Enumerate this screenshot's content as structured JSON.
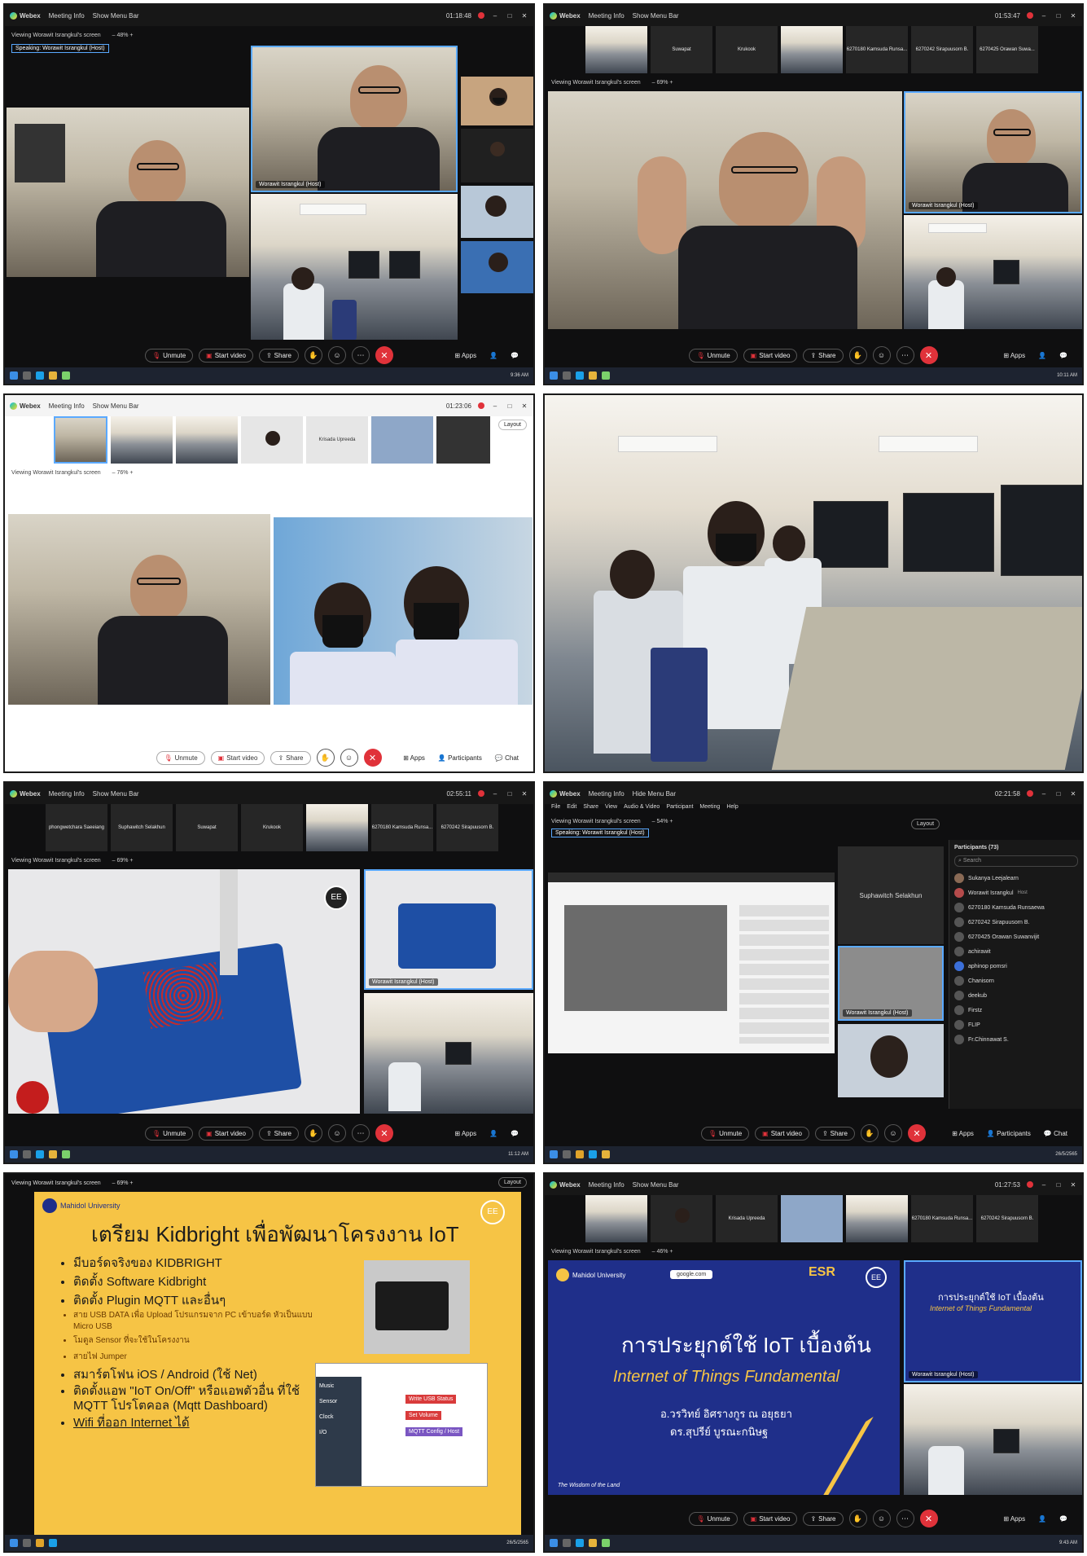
{
  "app": {
    "name": "Webex",
    "meeting_info": "Meeting Info",
    "show_menu_bar": "Show Menu Bar",
    "hide_menu_bar": "Hide Menu Bar",
    "layout": "Layout"
  },
  "controls": {
    "unmute": "Unmute",
    "start_video": "Start video",
    "share": "Share",
    "apps": "Apps",
    "participants": "Participants",
    "chat": "Chat"
  },
  "p1": {
    "timer": "01:18:48",
    "viewing": "Viewing Worawit Israngkul's screen",
    "zoom": "48%",
    "speaking": "Speaking: Worawit Israngkul (Host)",
    "host_caption": "Worawit Israngkul (Host)",
    "clock": "9:36 AM"
  },
  "p2": {
    "timer": "01:53:47",
    "viewing": "Viewing Worawit Israngkul's screen",
    "zoom": "69%",
    "host_caption": "Worawit Israngkul (Host)",
    "clock": "10:11 AM",
    "strip": [
      "Suwapat",
      "Krukook",
      "6270180 Kamsuda Runsa...",
      "6270242 Sirapuusorn B.",
      "6270425 Orawan Suwa..."
    ]
  },
  "p3": {
    "timer": "01:23:06",
    "viewing": "Viewing Worawit Israngkul's screen",
    "zoom": "76%",
    "strip_name": "Krisada Upreeda",
    "chat": "Chat"
  },
  "p5": {
    "timer": "02:55:11",
    "viewing": "Viewing Worawit Israngkul's screen",
    "zoom": "69%",
    "host_caption": "Worawit Israngkul (Host)",
    "clock": "11:12 AM",
    "strip": [
      "phongwetchara Saeeiang",
      "Suphawitch Selakhun",
      "Suwapat",
      "Krukook",
      "6270180 Kamsuda Runsa...",
      "6270242 Sirapuusorn B."
    ]
  },
  "p6": {
    "timer": "02:21:58",
    "viewing": "Viewing Worawit Israngkul's screen",
    "zoom": "54%",
    "speaking": "Speaking: Worawit Israngkul (Host)",
    "menu": [
      "File",
      "Edit",
      "Share",
      "View",
      "Audio & Video",
      "Participant",
      "Meeting",
      "Help"
    ],
    "participants_title": "Participants (73)",
    "search": "Search",
    "tile_name": "Suphawitch Selakhun",
    "host_caption": "Worawit Israngkul (Host)",
    "host_tag": "Host",
    "participants": [
      "Sukanya Leejalearn",
      "Worawit Israngkul",
      "6270180 Kamsuda Runsaewa",
      "6270242 Sirapuusorn B.",
      "6270425 Orawan Suwanvijit",
      "achirawit",
      "aphinop pomsri",
      "Chanisorn",
      "deekub",
      "Firstz",
      "FLIP",
      "Fr.Chinnawat S."
    ],
    "date": "26/5/2565"
  },
  "p7": {
    "viewing": "Viewing Worawit Israngkul's screen",
    "zoom": "69%",
    "layout": "Layout",
    "university": "Mahidol University",
    "slide_title": "เตรียม Kidbright เพื่อพัฒนาโครงงาน IoT",
    "bullets": [
      "มีบอร์ดจริงของ KIDBRIGHT",
      "ติดตั้ง Software Kidbright",
      "ติดตั้ง Plugin MQTT และอื่นๆ"
    ],
    "small_bullets": [
      "สาย USB DATA เพื่อ Upload โปรแกรมจาก PC เข้าบอร์ด หัวเป็นแบบ Micro USB",
      "โมดูล Sensor ที่จะใช้ในโครงงาน",
      "สายไฟ Jumper"
    ],
    "bullets2": [
      "สมาร์ตโฟน iOS / Android (ใช้ Net)",
      "ติดตั้งแอพ \"IoT On/Off\" หรือแอพตัวอื่น ที่ใช้ MQTT โปรโตคอล (Mqtt Dashboard)",
      "Wifi ที่ออก Internet ได้"
    ],
    "kb_menu": [
      "Music",
      "Sensor",
      "Clock",
      "I/O"
    ],
    "kb_write": "Write USB",
    "kb_status": "Status",
    "kb_volume": "Set Volume",
    "kb_mqtt": "MQTT Config",
    "kb_host": "Host",
    "date": "26/5/2565"
  },
  "p8": {
    "timer": "01:27:53",
    "viewing": "Viewing Worawit Israngkul's screen",
    "zoom": "46%",
    "strip_name": "Krisada Upreeda",
    "strip": [
      "6270180 Kamsuda Runsa...",
      "6270242 Sirapuusorn B."
    ],
    "university": "Mahidol University",
    "search_pill": "google.com",
    "esr": "ESR",
    "title_th": "การประยุกต์ใช้ IoT เบื้องต้น",
    "title_en": "Internet of Things Fundamental",
    "author1": "อ.วรวิทย์ อิศรางกูร ณ อยุธยา",
    "author2": "ดร.สุปรีย์ บูรณะกนิษฐ",
    "motto": "The Wisdom of the Land",
    "host_caption": "Worawit Israngkul (Host)",
    "clock": "9:43 AM"
  },
  "colors": {
    "accent": "#5aa9ff",
    "end": "#e0323a",
    "slide_yellow": "#f6c445",
    "slide_navy": "#1f2f8a"
  }
}
